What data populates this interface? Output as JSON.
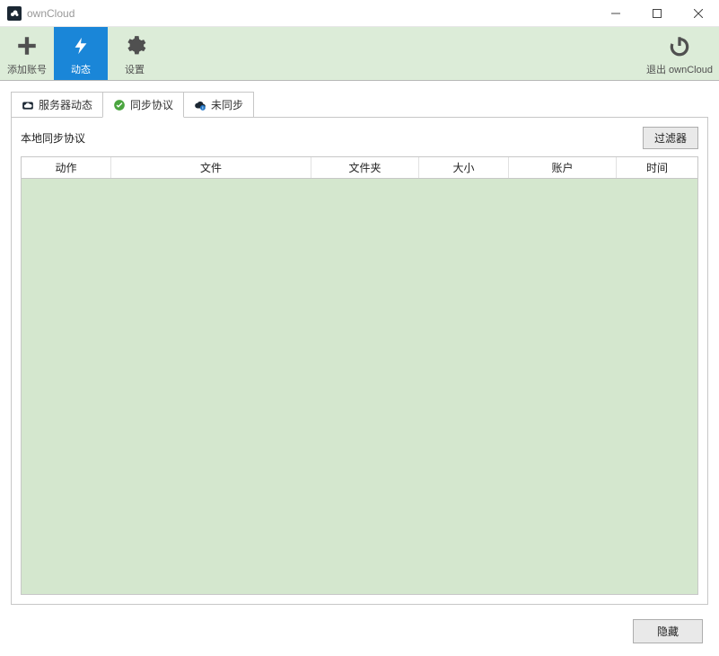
{
  "window": {
    "title": "ownCloud"
  },
  "toolbar": {
    "add_account": "添加账号",
    "activity": "动态",
    "settings": "设置",
    "quit": "退出 ownCloud"
  },
  "tabs": {
    "server_activity": "服务器动态",
    "sync_protocol": "同步协议",
    "not_synced": "未同步"
  },
  "pane": {
    "title": "本地同步协议",
    "filter_btn": "过滤器"
  },
  "columns": {
    "action": "动作",
    "file": "文件",
    "folder": "文件夹",
    "size": "大小",
    "account": "账户",
    "time": "时间"
  },
  "footer": {
    "hide": "隐藏"
  }
}
